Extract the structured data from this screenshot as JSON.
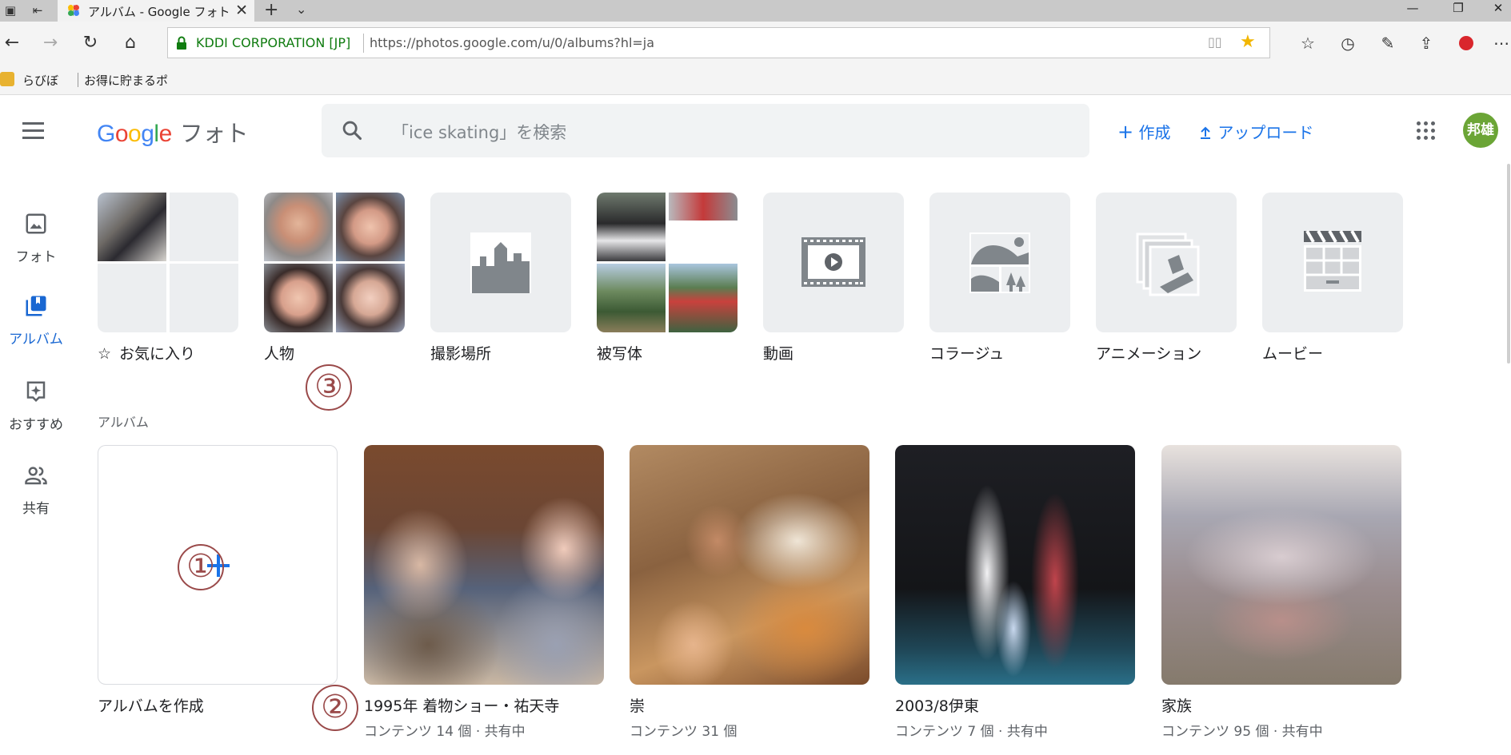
{
  "browser": {
    "tab_title": "アルバム - Google フォト",
    "cert_label": "KDDI CORPORATION [JP]",
    "url": "https://photos.google.com/u/0/albums?hl=ja",
    "bookmarks": [
      "らびぼ",
      "お得に貯まるポ"
    ]
  },
  "app": {
    "logo_google": "Google",
    "logo_product": "フォト",
    "search_placeholder": "「ice skating」を検索",
    "create_label": "作成",
    "upload_label": "アップロード",
    "avatar_text": "邦雄"
  },
  "sidebar": {
    "items": [
      {
        "label": "フォト",
        "icon": "photo-icon",
        "active": false
      },
      {
        "label": "アルバム",
        "icon": "album-icon",
        "active": true
      },
      {
        "label": "おすすめ",
        "icon": "assistant-icon",
        "active": false
      },
      {
        "label": "共有",
        "icon": "sharing-icon",
        "active": false
      }
    ]
  },
  "categories": [
    {
      "label": "お気に入り",
      "icon": "star-outline-icon"
    },
    {
      "label": "人物"
    },
    {
      "label": "撮影場所",
      "icon": "places-icon"
    },
    {
      "label": "被写体"
    },
    {
      "label": "動画",
      "icon": "video-icon"
    },
    {
      "label": "コラージュ",
      "icon": "collage-icon"
    },
    {
      "label": "アニメーション",
      "icon": "animation-icon"
    },
    {
      "label": "ムービー",
      "icon": "movie-clapper-icon"
    }
  ],
  "albums_section_label": "アルバム",
  "create_album_label": "アルバムを作成",
  "albums": [
    {
      "title": "1995年 着物ショー・祐天寺",
      "subtitle": "コンテンツ 14 個 · 共有中"
    },
    {
      "title": "崇",
      "subtitle": "コンテンツ 31 個"
    },
    {
      "title": "2003/8伊東",
      "subtitle": "コンテンツ 7 個 · 共有中"
    },
    {
      "title": "家族",
      "subtitle": "コンテンツ 95 個 · 共有中"
    }
  ],
  "annotations": [
    "①",
    "②",
    "③"
  ],
  "colors": {
    "accent": "#1a73e8",
    "avatar": "#6ba536",
    "annotation": "#9a4a4a"
  }
}
